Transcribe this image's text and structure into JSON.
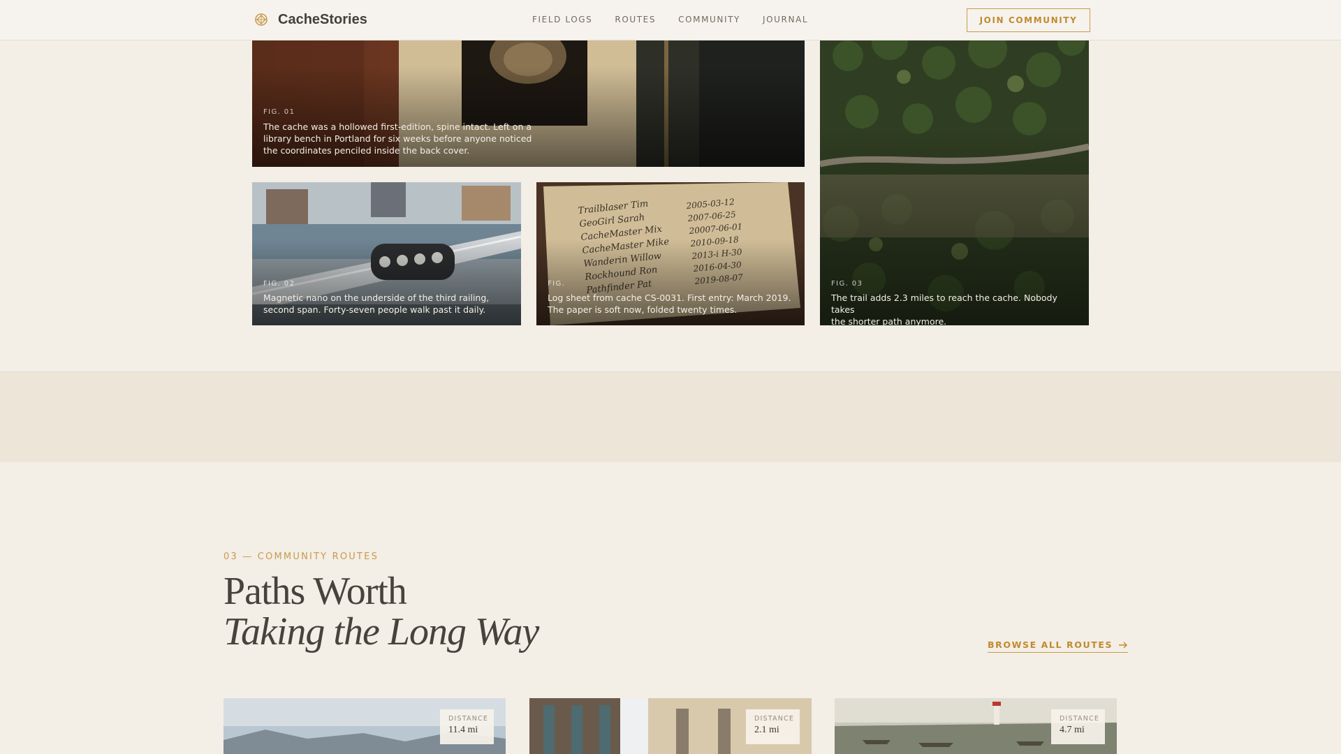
{
  "brand": {
    "name": "CacheStories"
  },
  "nav": {
    "links": [
      "FIELD LOGS",
      "ROUTES",
      "COMMUNITY",
      "JOURNAL"
    ],
    "cta": "JOIN COMMUNITY"
  },
  "gallery": {
    "figures": [
      {
        "label": "FIG. 01",
        "caption_lines": [
          "The cache was a hollowed first-edition, spine intact. Left on a",
          "library bench in Portland for six weeks before anyone noticed",
          "the coordinates penciled inside the back cover."
        ]
      },
      {
        "label": "FIG. 02",
        "caption_lines": [
          "Magnetic nano on the underside of the third railing,",
          "second span. Forty-seven people walk past it daily."
        ]
      },
      {
        "label": "FIG.",
        "caption_lines": [
          "Log sheet from cache CS-0031. First entry: March 2019.",
          "The paper is soft now, folded twenty times."
        ]
      },
      {
        "label": "FIG. 03",
        "caption_lines": [
          "The trail adds 2.3 miles to reach the cache. Nobody takes",
          "the shorter path anymore."
        ]
      }
    ],
    "logsheet_names": [
      "Trailblaser Tim",
      "GeoGirl Sarah",
      "CacheMaster Mix",
      "CacheMaster Mike",
      "Wanderin Willow",
      "Rockhound Ron",
      "Pathfinder Pat"
    ],
    "logsheet_dates": [
      "2005-03-12",
      "2007-06-25",
      "20007-06-01",
      "2010-09-18",
      "2013-i H-30",
      "2016-04-30",
      "2019-08-07"
    ]
  },
  "routes": {
    "eyebrow": "03 — COMMUNITY ROUTES",
    "heading_line1": "Paths Worth",
    "heading_line2": "Taking the Long Way",
    "browse_label": "BROWSE ALL ROUTES",
    "cards": [
      {
        "distance_label": "DISTANCE",
        "distance": "11.4 mi"
      },
      {
        "distance_label": "DISTANCE",
        "distance": "2.1 mi"
      },
      {
        "distance_label": "DISTANCE",
        "distance": "4.7 mi"
      }
    ]
  },
  "colors": {
    "accent": "#c99a4c",
    "background": "#f3eee6",
    "band": "#ede5d8",
    "text": "#47423c"
  },
  "icons": {
    "logo": "compass-mark-icon",
    "browse_arrow": "arrow-right-icon"
  }
}
